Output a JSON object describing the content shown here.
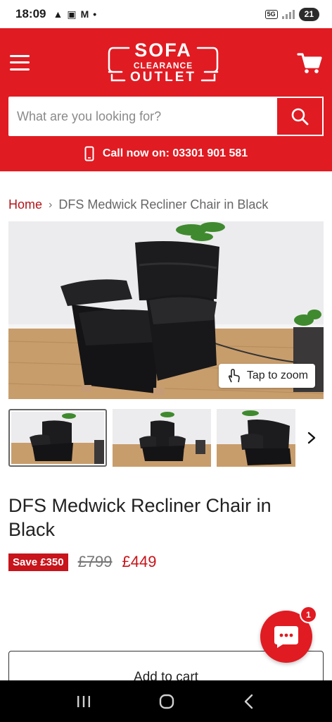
{
  "status": {
    "time": "18:09",
    "net": "5G",
    "battery": "21"
  },
  "header": {
    "logo": {
      "line1": "SOFA",
      "line2": "CLEARANCE",
      "line3": "OUTLET"
    },
    "search_placeholder": "What are you looking for?",
    "call_text": "Call now on: 03301 901 581"
  },
  "breadcrumb": {
    "home": "Home",
    "separator": "›",
    "current": "DFS Medwick Recliner Chair in Black"
  },
  "gallery": {
    "zoom_label": "Tap to zoom"
  },
  "product": {
    "title": "DFS Medwick Recliner Chair in Black",
    "save_badge": "Save £350",
    "old_price": "£799",
    "price": "£449",
    "add_to_cart": "Add to cart"
  },
  "chat": {
    "badge_count": "1"
  },
  "colors": {
    "brand_red": "#e11b22",
    "price_red": "#c8141b"
  }
}
